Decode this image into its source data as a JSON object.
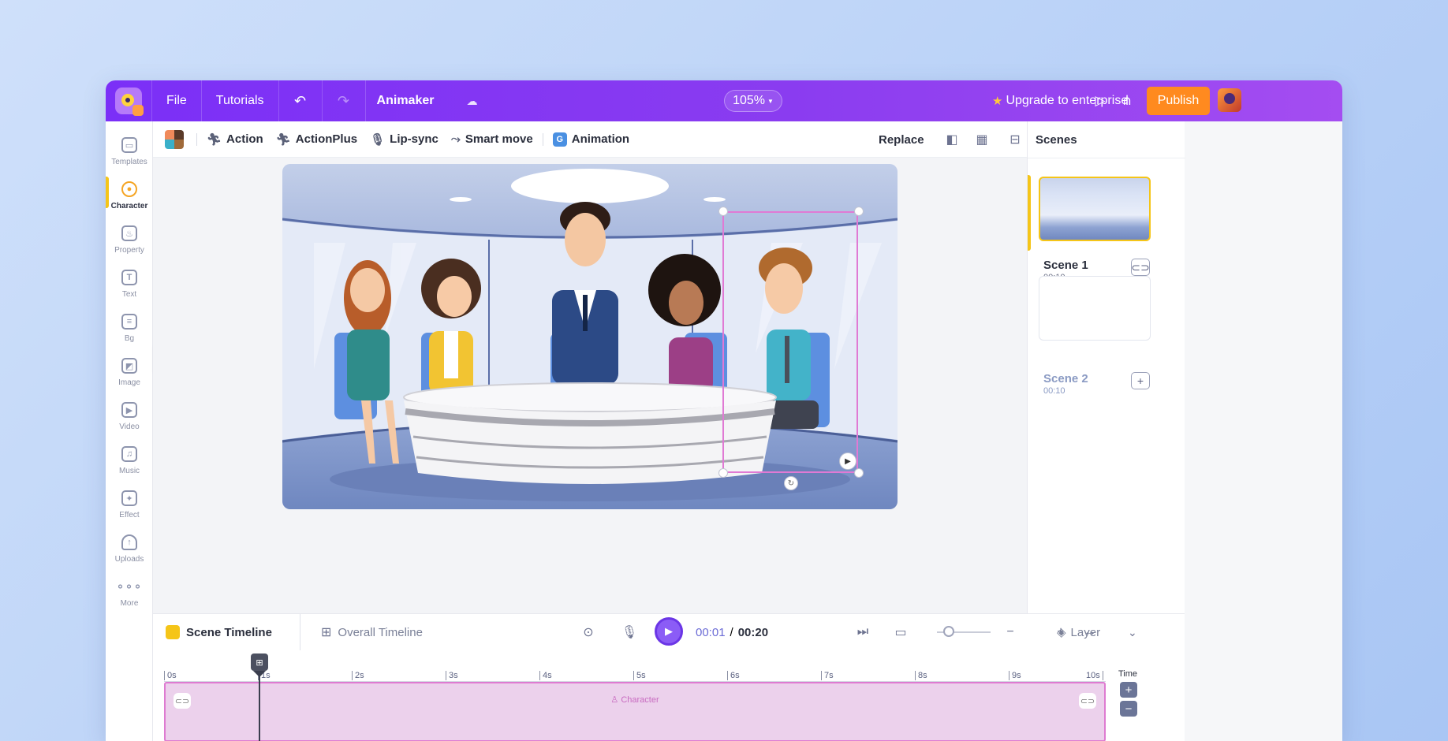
{
  "topbar": {
    "file": "File",
    "tutorials": "Tutorials",
    "project_name": "Animaker",
    "zoom": "105%",
    "upgrade": "Upgrade to enterprise",
    "publish": "Publish"
  },
  "sidebar": {
    "items": [
      {
        "label": "Templates",
        "icon": "templates-icon"
      },
      {
        "label": "Character",
        "icon": "character-icon"
      },
      {
        "label": "Property",
        "icon": "property-icon"
      },
      {
        "label": "Text",
        "icon": "text-icon"
      },
      {
        "label": "Bg",
        "icon": "bg-icon"
      },
      {
        "label": "Image",
        "icon": "image-icon"
      },
      {
        "label": "Video",
        "icon": "video-icon"
      },
      {
        "label": "Music",
        "icon": "music-icon"
      },
      {
        "label": "Effect",
        "icon": "effect-icon"
      },
      {
        "label": "Uploads",
        "icon": "uploads-icon"
      },
      {
        "label": "More",
        "icon": "more-icon"
      }
    ],
    "active": "Character"
  },
  "toolbar": {
    "action": "Action",
    "actionplus": "ActionPlus",
    "lipsync": "Lip-sync",
    "smartmove": "Smart move",
    "animation": "Animation",
    "replace": "Replace"
  },
  "scenes": {
    "title": "Scenes",
    "list": [
      {
        "name": "Scene 1",
        "duration": "00:10"
      },
      {
        "name": "Scene 2",
        "duration": "00:10"
      }
    ]
  },
  "timeline": {
    "scene_tab": "Scene Timeline",
    "overall_tab": "Overall Timeline",
    "current": "00:01",
    "separator": "/",
    "total": "00:20",
    "layer": "Layer",
    "ruler": [
      "0s",
      "1s",
      "2s",
      "3s",
      "4s",
      "5s",
      "6s",
      "7s",
      "8s",
      "9s",
      "10s"
    ],
    "track_label": "Character",
    "time_label": "Time"
  },
  "colors": {
    "topbar": "#7b2ff7",
    "publish": "#ff8a1f",
    "accent": "#f5c518",
    "selection": "#e07ad4",
    "play": "#8b5cf6"
  }
}
